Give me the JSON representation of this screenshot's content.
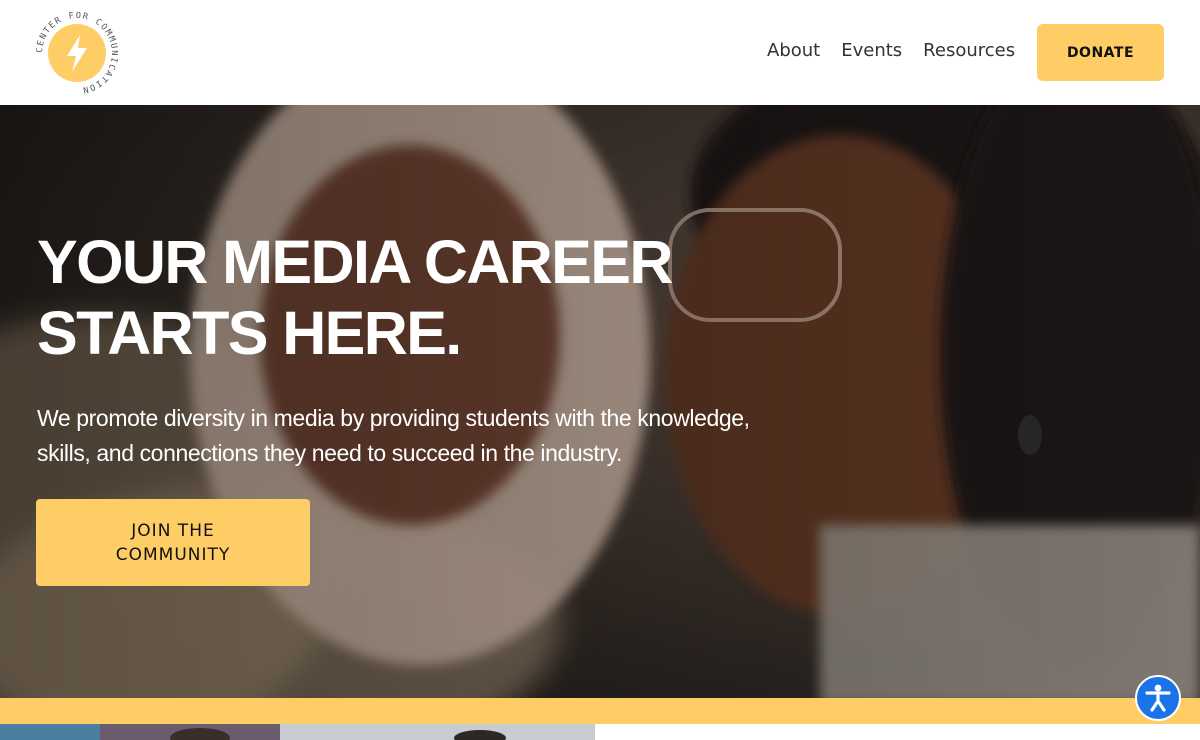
{
  "logo": {
    "ring_text": "CENTER FOR COMMUNICATION",
    "icon": "lightning-bolt-icon",
    "circle_color": "#ffcd66"
  },
  "nav": {
    "items": [
      "About",
      "Events",
      "Resources"
    ]
  },
  "header": {
    "donate_label": "DONATE"
  },
  "hero": {
    "headline": "YOUR MEDIA CAREER STARTS HERE.",
    "subtext": "We promote diversity in media by providing students with the knowledge, skills, and connections they need to succeed in the industry.",
    "cta_line1": "JOIN THE",
    "cta_line2": "COMMUNITY"
  },
  "accessibility": {
    "icon": "accessibility-person-icon",
    "color": "#1a73e8"
  },
  "colors": {
    "accent": "#ffcd66",
    "text_dark": "#333333",
    "hero_text": "#ffffff"
  }
}
